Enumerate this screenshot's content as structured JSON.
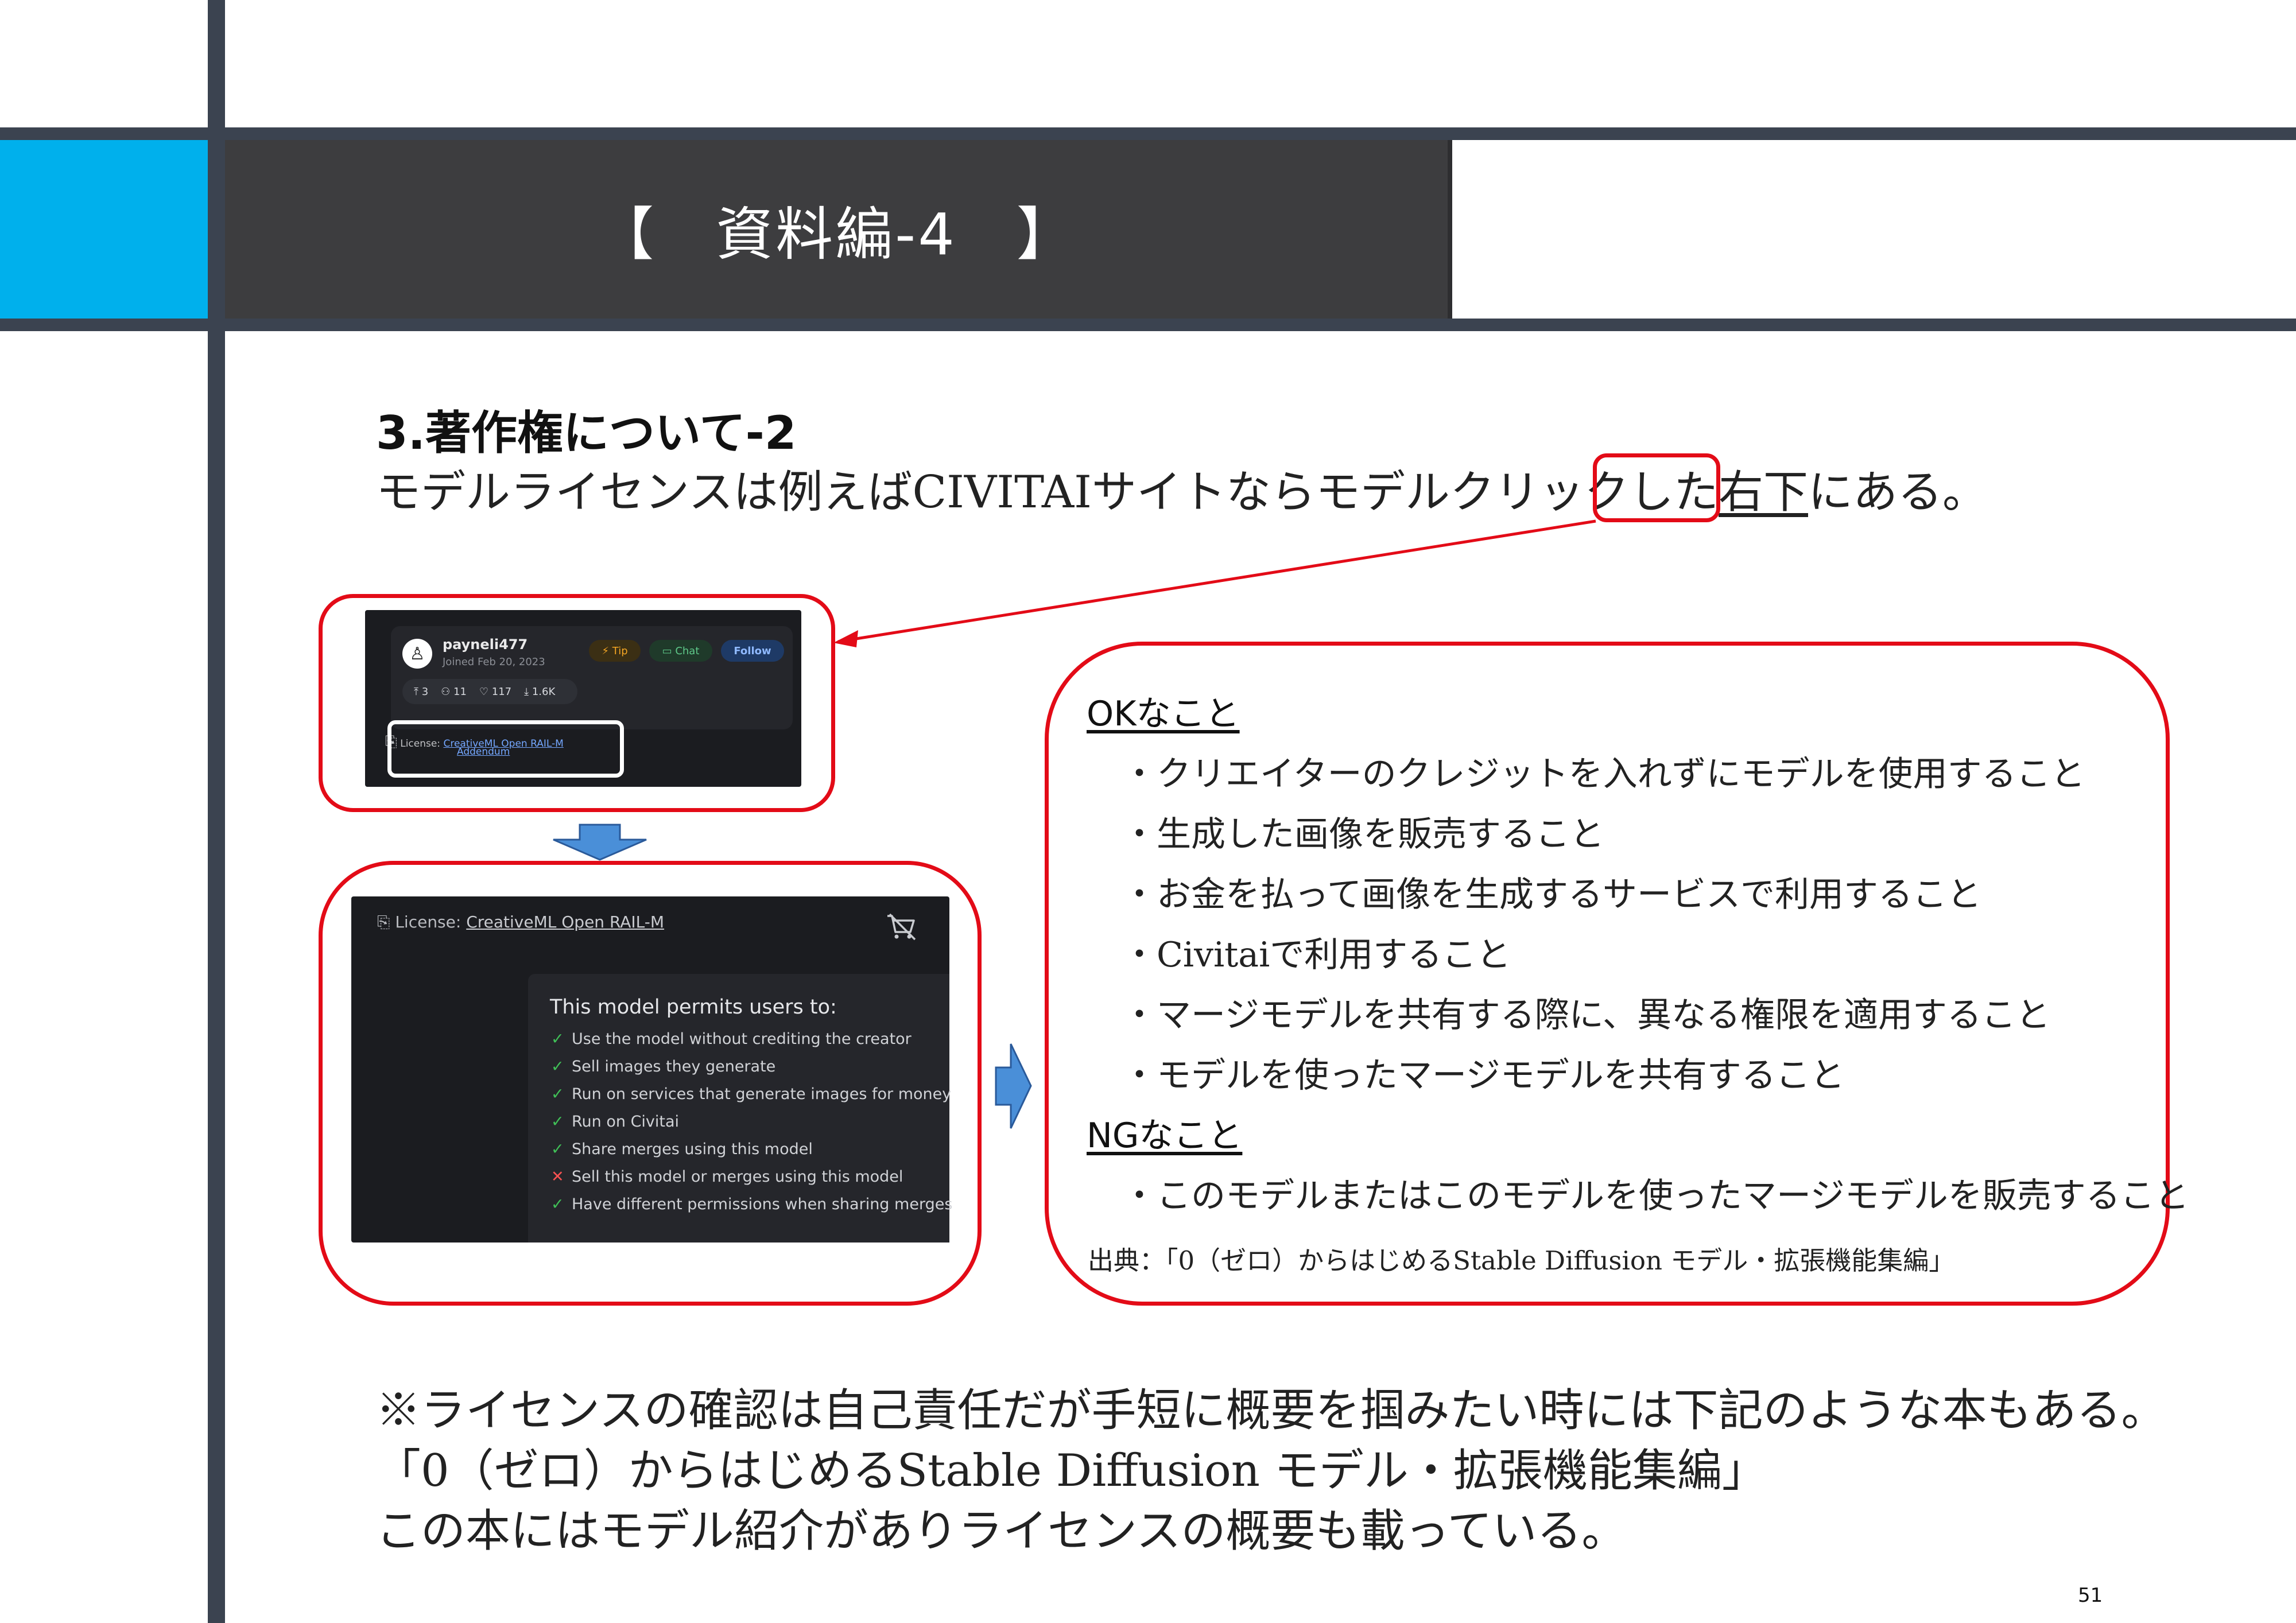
{
  "slide": {
    "title": "【　資料編-4　】",
    "page_number": "51"
  },
  "section": {
    "heading": "3.著作権について-2",
    "intro_before": "モデルライセンスは例えばCIVITAIサイトならモデルクリックした",
    "intro_highlight": "右下",
    "intro_after": "にある。"
  },
  "screenshot_profile": {
    "username": "payneli477",
    "joined": "Joined Feb 20, 2023",
    "tip_label": "Tip",
    "chat_label": "Chat",
    "follow_label": "Follow",
    "stats": [
      "3",
      "11",
      "117",
      "1.6K"
    ],
    "license_prefix": "License:",
    "license_link_1": "CreativeML Open RAIL-M",
    "license_link_2": "Addendum"
  },
  "screenshot_license": {
    "license_prefix": "License:",
    "license_link": "CreativeML Open RAIL-M",
    "permits_title": "This model permits users to:",
    "permissions": [
      {
        "mark": "✓",
        "status": "ok",
        "text": "Use the model without crediting the creator"
      },
      {
        "mark": "✓",
        "status": "ok",
        "text": "Sell images they generate"
      },
      {
        "mark": "✓",
        "status": "ok",
        "text": "Run on services that generate images for money"
      },
      {
        "mark": "✓",
        "status": "ok",
        "text": "Run on Civitai"
      },
      {
        "mark": "✓",
        "status": "ok",
        "text": "Share merges using this model"
      },
      {
        "mark": "✕",
        "status": "ng",
        "text": "Sell this model or merges using this model"
      },
      {
        "mark": "✓",
        "status": "ok",
        "text": "Have different permissions when sharing merges"
      }
    ]
  },
  "summary": {
    "ok_heading": "OKなこと",
    "ok_items": [
      "・クリエイターのクレジットを入れずにモデルを使用すること",
      "・生成した画像を販売すること",
      "・お金を払って画像を生成するサービスで利用すること",
      "・Civitaiで利用すること",
      "・マージモデルを共有する際に、異なる権限を適用すること",
      "・モデルを使ったマージモデルを共有すること"
    ],
    "ng_heading": "NGなこと",
    "ng_items": [
      "・このモデルまたはこのモデルを使ったマージモデルを販売すること"
    ],
    "source": "出典：「0（ゼロ）からはじめるStable Diffusion モデル・拡張機能集編」"
  },
  "notes": [
    "※ライセンスの確認は自己責任だが手短に概要を掴みたい時には下記のような本もある。",
    "「0（ゼロ）からはじめるStable Diffusion モデル・拡張機能集編」",
    "この本にはモデル紹介がありライセンスの概要も載っている。"
  ],
  "colors": {
    "frame": "#3b4350",
    "accent_blue": "#00b0ec",
    "title_bar": "#3d3d3f",
    "callout_red": "#e30b17",
    "arrow_blue": "#4a8fd8"
  },
  "icons": {
    "license": "license-icon",
    "cart": "cart-off-icon",
    "down_arrow": "block-arrow-down-icon",
    "right_arrow": "block-arrow-right-icon"
  }
}
